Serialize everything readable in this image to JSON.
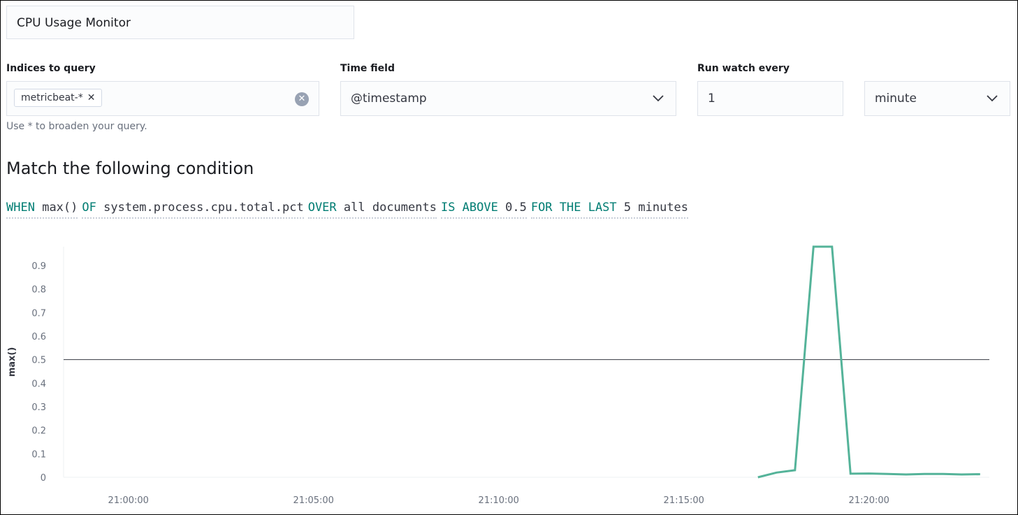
{
  "watch_name": "CPU Usage Monitor",
  "indices": {
    "label": "Indices to query",
    "chip": "metricbeat-*",
    "help": "Use * to broaden your query."
  },
  "time_field": {
    "label": "Time field",
    "value": "@timestamp"
  },
  "run_watch": {
    "label": "Run watch every",
    "value": "1",
    "unit": "minute"
  },
  "condition": {
    "heading": "Match the following condition",
    "parts": [
      {
        "kw": "WHEN",
        "val": "max()"
      },
      {
        "kw": "OF",
        "val": "system.process.cpu.total.pct"
      },
      {
        "kw": "OVER",
        "val": "all documents"
      },
      {
        "kw": "IS ABOVE",
        "val": "0.5"
      },
      {
        "kw": "FOR THE LAST",
        "val": "5 minutes"
      }
    ]
  },
  "colors": {
    "series": "#54b399",
    "threshold": "#343741",
    "keyword": "#017d73"
  },
  "icons": {
    "chip_remove": "cross-icon",
    "clear": "clear-icon",
    "dropdown": "chevron-down-icon"
  },
  "chart_data": {
    "type": "line",
    "ylabel": "max()",
    "ylim": [
      0,
      0.98
    ],
    "yticks": [
      0,
      0.1,
      0.2,
      0.3,
      0.4,
      0.5,
      0.6,
      0.7,
      0.8,
      0.9
    ],
    "xticks": [
      "21:00:00",
      "21:05:00",
      "21:10:00",
      "21:15:00",
      "21:20:00"
    ],
    "xlim": [
      "20:58:15",
      "21:23:15"
    ],
    "threshold": 0.5,
    "series": [
      {
        "x": [
          "21:17:00",
          "21:17:30",
          "21:18:00",
          "21:18:30",
          "21:19:00",
          "21:19:30",
          "21:20:00",
          "21:20:30",
          "21:21:00",
          "21:21:30",
          "21:22:00",
          "21:22:30",
          "21:23:00"
        ],
        "y": [
          0.0,
          0.02,
          0.03,
          0.98,
          0.98,
          0.015,
          0.016,
          0.014,
          0.012,
          0.014,
          0.014,
          0.012,
          0.013
        ]
      }
    ]
  }
}
